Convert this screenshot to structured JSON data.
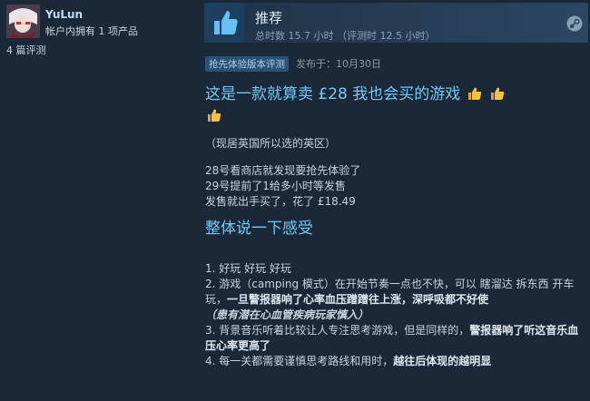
{
  "author": {
    "name": "YuLun",
    "products": "帐户内拥有 1 项产品",
    "reviews": "4 篇评测"
  },
  "review": {
    "verdict": "推荐",
    "hours": "总时数 15.7 小时 （评测时 12.5 小时）",
    "early_access_tag": "抢先体验版本评测",
    "posted": "发布于：10月30日",
    "headline": "这是一款就算卖 £28 我也会买的游戏",
    "region_note": "（现居英国所以选的英区）",
    "lines": [
      "28号看商店就发现要抢先体验了",
      "29号提前了1给多小时等发售",
      "发售就出手买了，花了 £18.49"
    ],
    "subheading": "整体说一下感受",
    "points": {
      "p1": "1. 好玩 好玩 好玩",
      "p2_a": "2. 游戏（camping 模式）在开始节奏一点也不快，可以 瞎溜达 拆东西 开车 玩，",
      "p2_b": "一旦警报器响了心率血压蹭蹭往上涨，深呼吸都不好使",
      "p2_c": "（患有潜在心血管疾病玩家慎入）",
      "p3_a": "3. 背景音乐听着比较让人专注思考游戏，但是同样的，",
      "p3_b": "警报器响了听这音乐血压心率更高了",
      "p4_a": "4. 每一关都需要谨慎思考路线和用时，",
      "p4_b": "越往后体现的越明显"
    }
  },
  "colors": {
    "background": "#1b2838",
    "accent": "#6fcbf5",
    "tag_bg": "#2a5273"
  },
  "icons": [
    "avatar",
    "thumbs-up-icon",
    "steam-icon",
    "thumbs-up-emoji"
  ]
}
